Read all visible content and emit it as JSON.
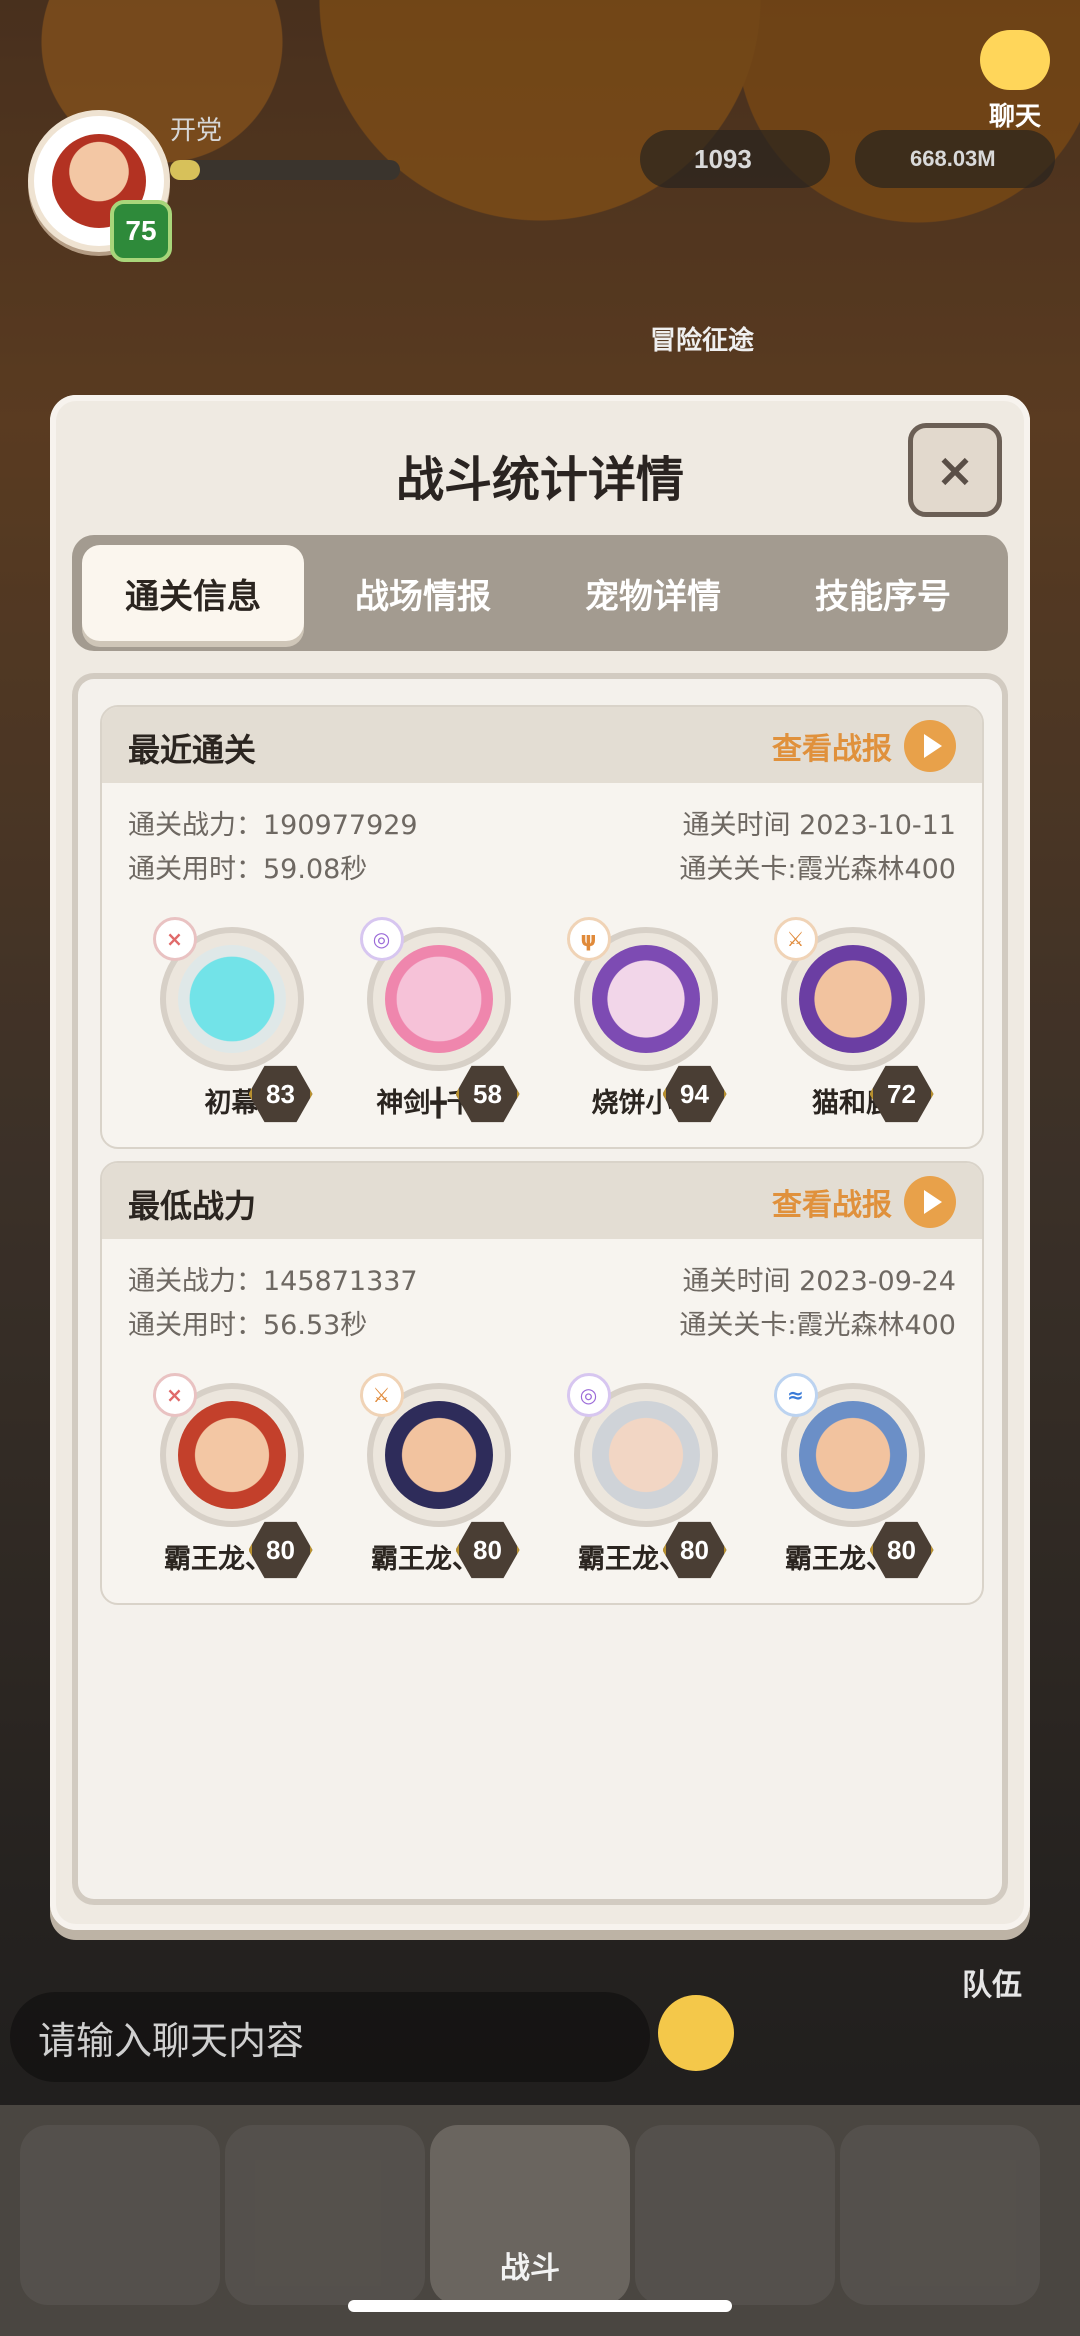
{
  "hud": {
    "player_label": "开党",
    "level": "75",
    "resource_1": "1093",
    "resource_2": "668.03M",
    "chat_corner_label": "聊天",
    "adventure_label": "冒险征途"
  },
  "modal": {
    "title": "战斗统计详情",
    "close": "×",
    "tabs": [
      {
        "label": "通关信息"
      },
      {
        "label": "战场情报"
      },
      {
        "label": "宠物详情"
      },
      {
        "label": "技能序号"
      }
    ],
    "sections": [
      {
        "title": "最近通关",
        "report_label": "查看战报",
        "power_label": "通关战力：",
        "power": "190977929",
        "time_label": "通关用时：",
        "time": "59.08秒",
        "date_label": "通关时间",
        "date": "2023-10-11",
        "stage_label": "通关关卡:",
        "stage": "霞光森林400",
        "pets": [
          {
            "name": "初幕",
            "level": "83"
          },
          {
            "name": "神剑╋千菁",
            "level": "58"
          },
          {
            "name": "烧饼小子",
            "level": "94"
          },
          {
            "name": "猫和鹿",
            "level": "72"
          }
        ]
      },
      {
        "title": "最低战力",
        "report_label": "查看战报",
        "power_label": "通关战力：",
        "power": "145871337",
        "time_label": "通关用时：",
        "time": "56.53秒",
        "date_label": "通关时间",
        "date": "2023-09-24",
        "stage_label": "通关关卡:",
        "stage": "霞光森林400",
        "pets": [
          {
            "name": "霸王龙、斗",
            "level": "80"
          },
          {
            "name": "霸王龙、刺",
            "level": "80"
          },
          {
            "name": "霸王龙、术",
            "level": "80"
          },
          {
            "name": "霸王龙、德",
            "level": "80"
          }
        ]
      }
    ]
  },
  "chat": {
    "placeholder": "请输入聊天内容",
    "team_label": "队伍"
  },
  "nav": {
    "battle_label": "战斗"
  }
}
